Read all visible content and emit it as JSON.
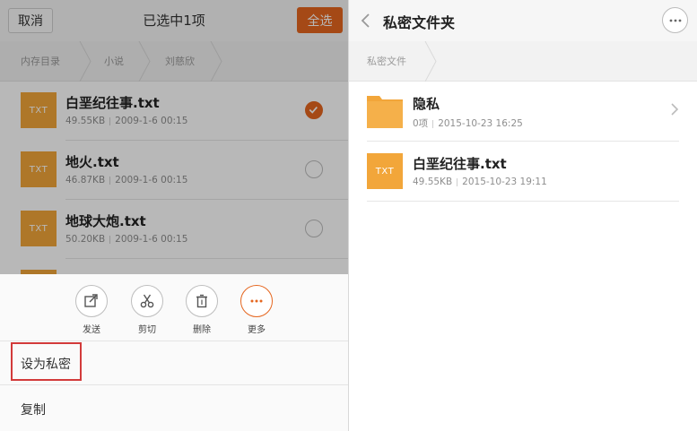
{
  "left": {
    "cancel_label": "取消",
    "title": "已选中1项",
    "select_all_label": "全选",
    "breadcrumb": [
      "内存目录",
      "小说",
      "刘慈欣"
    ],
    "files": [
      {
        "icon_text": "TXT",
        "name": "白垩纪往事.txt",
        "size": "49.55KB",
        "date": "2009-1-6 00:15",
        "checked": true
      },
      {
        "icon_text": "TXT",
        "name": "地火.txt",
        "size": "46.87KB",
        "date": "2009-1-6 00:15",
        "checked": false
      },
      {
        "icon_text": "TXT",
        "name": "地球大炮.txt",
        "size": "50.20KB",
        "date": "2009-1-6 00:15",
        "checked": false
      }
    ],
    "actions": [
      {
        "icon": "share-icon",
        "label": "发送"
      },
      {
        "icon": "scissors-icon",
        "label": "剪切"
      },
      {
        "icon": "trash-icon",
        "label": "删除"
      },
      {
        "icon": "more-dots-icon",
        "label": "更多"
      }
    ],
    "menu": [
      "设为私密",
      "复制"
    ]
  },
  "right": {
    "title": "私密文件夹",
    "breadcrumb": [
      "私密文件"
    ],
    "items": [
      {
        "type": "folder",
        "name": "隐私",
        "count": "0项",
        "date": "2015-10-23 16:25"
      },
      {
        "type": "file",
        "icon_text": "TXT",
        "name": "白垩纪往事.txt",
        "size": "49.55KB",
        "date": "2015-10-23 19:11"
      }
    ]
  },
  "colors": {
    "accent": "#e5661f",
    "file_icon": "#f2a63a",
    "folder_icon": "#f2a63a",
    "highlight": "#d23a3a"
  }
}
